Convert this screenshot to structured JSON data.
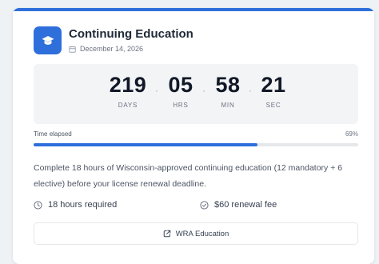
{
  "card": {
    "title": "Continuing Education",
    "date": "December 14, 2026",
    "icon": "graduation-cap-icon",
    "accent_color": "#2f6fdc"
  },
  "countdown": {
    "days": {
      "value": "219",
      "label": "DAYS"
    },
    "hours": {
      "value": "05",
      "label": "HRS"
    },
    "minutes": {
      "value": "58",
      "label": "MIN"
    },
    "seconds": {
      "value": "21",
      "label": "SEC"
    }
  },
  "progress": {
    "label": "Time elapsed",
    "percent_label": "69%",
    "fraction": 0.69
  },
  "description": "Complete 18 hours of Wisconsin-approved continuing education (12 mandatory + 6 elective) before your license renewal deadline.",
  "details": {
    "hours": "18 hours required",
    "fee": "$60 renewal fee"
  },
  "link": {
    "label": "WRA Education",
    "icon": "external-link-icon"
  }
}
